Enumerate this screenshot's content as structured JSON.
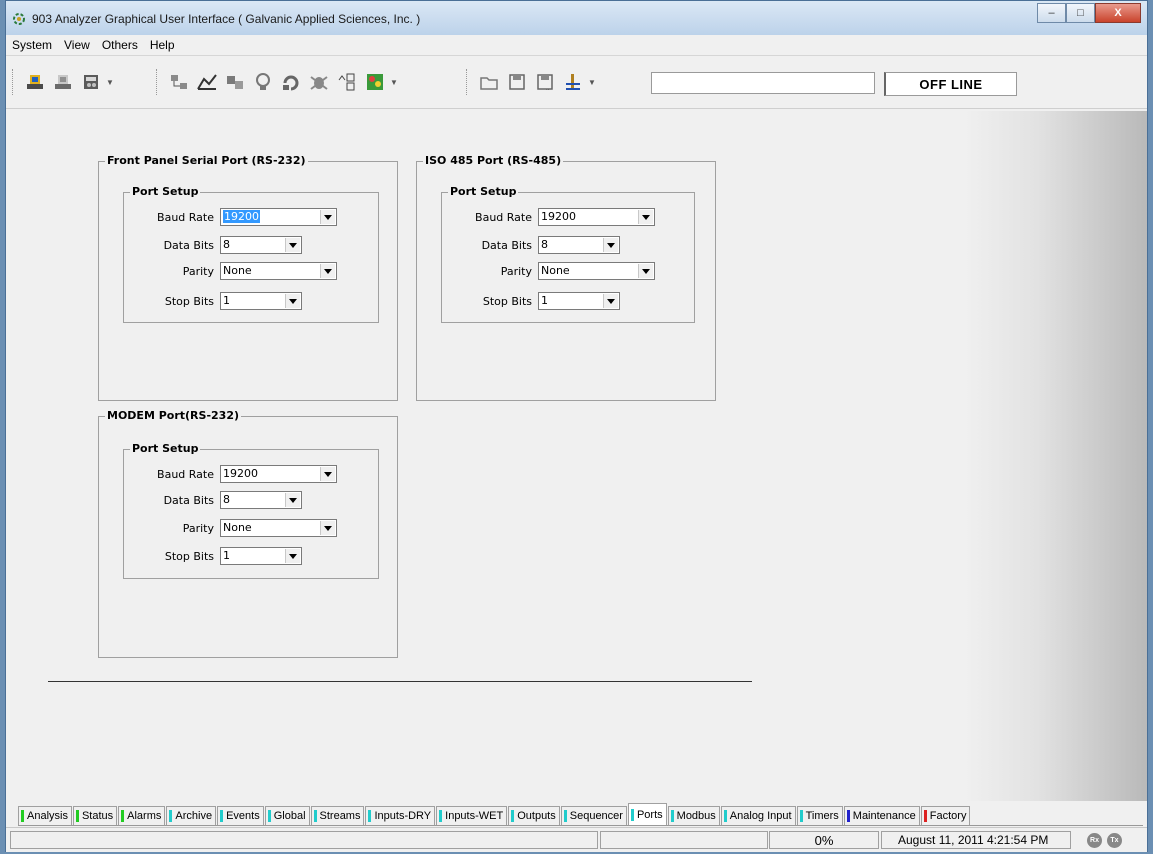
{
  "window": {
    "title": "903 Analyzer Graphical User Interface  ( Galvanic Applied Sciences, Inc. )",
    "minimize": "–",
    "maximize": "□",
    "close": "X"
  },
  "menu": [
    "System",
    "View",
    "Others",
    "Help"
  ],
  "toolbar": {
    "field_value": "",
    "status": "OFF LINE"
  },
  "panels": {
    "front": {
      "title": "Front Panel Serial Port (RS-232)",
      "setup_title": "Port Setup",
      "baud_label": "Baud Rate",
      "baud": "19200",
      "databits_label": "Data Bits",
      "databits": "8",
      "parity_label": "Parity",
      "parity": "None",
      "stopbits_label": "Stop Bits",
      "stopbits": "1"
    },
    "iso": {
      "title": "ISO 485 Port (RS-485)",
      "setup_title": "Port Setup",
      "baud_label": "Baud Rate",
      "baud": "19200",
      "databits_label": "Data Bits",
      "databits": "8",
      "parity_label": "Parity",
      "parity": "None",
      "stopbits_label": "Stop Bits",
      "stopbits": "1"
    },
    "modem": {
      "title": "MODEM Port(RS-232)",
      "setup_title": "Port Setup",
      "baud_label": "Baud Rate",
      "baud": "19200",
      "databits_label": "Data Bits",
      "databits": "8",
      "parity_label": "Parity",
      "parity": "None",
      "stopbits_label": "Stop Bits",
      "stopbits": "1"
    }
  },
  "tabs": [
    {
      "label": "Analysis",
      "color": "#22cc22"
    },
    {
      "label": "Status",
      "color": "#22cc22"
    },
    {
      "label": "Alarms",
      "color": "#22cc22"
    },
    {
      "label": "Archive",
      "color": "#22cccc"
    },
    {
      "label": "Events",
      "color": "#22cccc"
    },
    {
      "label": "Global",
      "color": "#22cccc"
    },
    {
      "label": "Streams",
      "color": "#22cccc"
    },
    {
      "label": "Inputs-DRY",
      "color": "#22cccc"
    },
    {
      "label": "Inputs-WET",
      "color": "#22cccc"
    },
    {
      "label": "Outputs",
      "color": "#22cccc"
    },
    {
      "label": "Sequencer",
      "color": "#22cccc"
    },
    {
      "label": "Ports",
      "color": "#22cccc",
      "active": true
    },
    {
      "label": "Modbus",
      "color": "#22cccc"
    },
    {
      "label": "Analog Input",
      "color": "#22cccc"
    },
    {
      "label": "Timers",
      "color": "#22cccc"
    },
    {
      "label": "Maintenance",
      "color": "#2222cc"
    },
    {
      "label": "Factory",
      "color": "#dd2222"
    }
  ],
  "statusbar": {
    "progress": "0%",
    "datetime": "August 11, 2011 4:21:54 PM",
    "rx": "Rx",
    "tx": "Tx"
  }
}
